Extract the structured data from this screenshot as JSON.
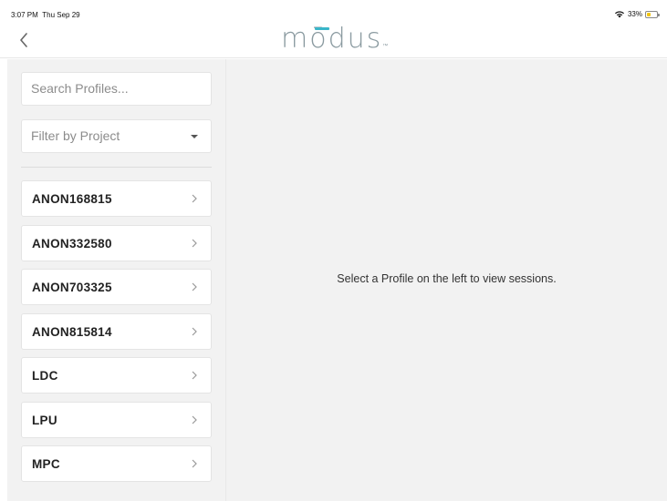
{
  "status_bar": {
    "time": "3:07 PM",
    "date": "Thu Sep 29",
    "battery": "33%",
    "battery_level": 0.33,
    "battery_color": "#f1c40f"
  },
  "nav": {
    "back_icon": "chevron-left-icon",
    "logo": "modus",
    "logo_text": "mōdus",
    "logo_tm": "™",
    "logo_accent_color": "#39b6c9"
  },
  "sidebar": {
    "search_placeholder": "Search Profiles...",
    "filter_placeholder": "Filter by Project",
    "profiles": [
      {
        "label": "ANON168815"
      },
      {
        "label": "ANON332580"
      },
      {
        "label": "ANON703325"
      },
      {
        "label": "ANON815814"
      },
      {
        "label": "LDC"
      },
      {
        "label": "LPU"
      },
      {
        "label": "MPC"
      }
    ]
  },
  "main": {
    "empty_message": "Select a Profile on the left to view sessions."
  }
}
